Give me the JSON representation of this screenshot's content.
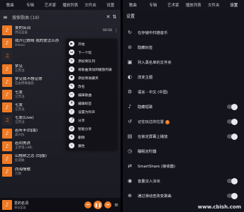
{
  "left": {
    "tabs": [
      "歌曲",
      "专辑",
      "艺术家",
      "播放列表",
      "文件夹",
      "设置"
    ],
    "search": {
      "text": "搜索歌曲 (19)"
    },
    "songs": [
      {
        "title": "爱的名词",
        "artist": "周征蓝鲨",
        "duration": "00:56",
        "thumb": "♪"
      },
      {
        "title": "我开已放晴 我的爱怎么办",
        "artist": "Adasic",
        "duration": "",
        "thumb": "♪"
      },
      {
        "title": "",
        "artist": "",
        "duration": "",
        "thumb": "♫"
      },
      {
        "title": "梦见",
        "artist": "汪苏泷",
        "duration": "",
        "thumb": "♪"
      },
      {
        "title": "梦见我不想见你",
        "artist": "自由特殊雅民",
        "duration": "",
        "thumb": "♪"
      },
      {
        "title": "七友",
        "artist": "汪苏泷",
        "duration": "",
        "thumb": "♪"
      },
      {
        "title": "七友",
        "artist": "汪苏泷",
        "duration": "",
        "thumb": "♪"
      },
      {
        "title": "七友(Live)",
        "artist": "汪苏泷",
        "duration": "",
        "thumb": "♫"
      },
      {
        "title": "若听半(DJ版)",
        "artist": "高兴乐",
        "duration": "",
        "thumb": "♪"
      },
      {
        "title": "若同男孩",
        "artist": "王梦琪 LINE",
        "duration": "",
        "thumb": "♪"
      },
      {
        "title": "山楂树之恋 (DJ版)",
        "artist": "彭淑敏",
        "duration": "",
        "thumb": "♪"
      },
      {
        "title": "西海情歌",
        "artist": "刀郎",
        "duration": "",
        "thumb": "♪"
      }
    ],
    "context_menu": [
      "开始",
      "下一个玩",
      "添加到队列",
      "将歌曲添加到播放列表",
      "添加到收藏夹",
      "改名",
      "编辑歌曲",
      "编辑标签",
      "设置为铃声",
      "分享",
      "智能分享",
      "删除",
      "属性"
    ],
    "player": {
      "title": "爱的名词",
      "artist": "周征蓝鲨"
    }
  },
  "right": {
    "tabs": [
      "歌曲",
      "专辑",
      "艺术家",
      "播放列表",
      "文件夹",
      "设置"
    ],
    "settings_title": "设置",
    "settings": [
      {
        "label": "在存储中扫描音乐",
        "icon": "↻",
        "toggle": false
      },
      {
        "label": "隐藏标签",
        "icon": "⊘",
        "toggle": false
      },
      {
        "label": "列入黑名单的文件夹",
        "icon": "▣",
        "toggle": false
      },
      {
        "label": "改变主题",
        "icon": "◐",
        "toggle": false
      },
      {
        "label": "语言 - 中文 (中国)",
        "icon": "⚙",
        "toggle": false
      },
      {
        "label": "隐藏短歌",
        "icon": "♪",
        "toggle": true
      },
      {
        "label": "记住玩过的位置",
        "icon": "↺",
        "toggle": true,
        "info": "!"
      },
      {
        "label": "在锁定屏幕上播放",
        "icon": "▤",
        "toggle": true
      },
      {
        "label": "睡眠定时器",
        "icon": "◷",
        "toggle": false
      },
      {
        "label": "SmartShare (接收器)",
        "icon": "⇄",
        "toggle": false
      },
      {
        "label": "音量淡入淡出",
        "icon": "◉",
        "toggle": true
      },
      {
        "label": "通过滑动查改变歌曲",
        "icon": "⊕",
        "toggle": true
      }
    ]
  },
  "watermark": "www.cbish.com"
}
